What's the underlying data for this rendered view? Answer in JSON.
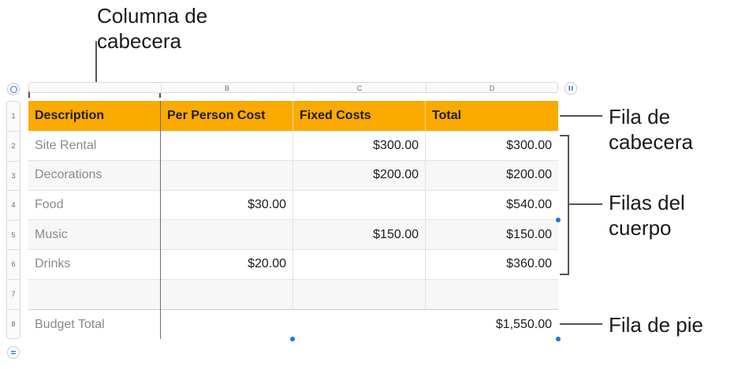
{
  "annotations": {
    "header_column": [
      "Columna de",
      "cabecera"
    ],
    "header_row": [
      "Fila de",
      "cabecera"
    ],
    "body_rows": [
      "Filas del",
      "cuerpo"
    ],
    "footer_row": [
      "Fila de pie"
    ]
  },
  "column_letters": [
    "B",
    "C",
    "D"
  ],
  "row_numbers": [
    "1",
    "2",
    "3",
    "4",
    "5",
    "6",
    "7",
    "8"
  ],
  "table": {
    "header": [
      "Description",
      "Per Person Cost",
      "Fixed Costs",
      "Total"
    ],
    "rows": [
      [
        "Site Rental",
        "",
        "$300.00",
        "$300.00"
      ],
      [
        "Decorations",
        "",
        "$200.00",
        "$200.00"
      ],
      [
        "Food",
        "$30.00",
        "",
        "$540.00"
      ],
      [
        "Music",
        "",
        "$150.00",
        "$150.00"
      ],
      [
        "Drinks",
        "$20.00",
        "",
        "$360.00"
      ],
      [
        "",
        "",
        "",
        ""
      ]
    ],
    "footer": [
      "Budget Total",
      "",
      "",
      "$1,550.00"
    ]
  },
  "colors": {
    "header_fill": "#fbaa00",
    "selection_handle": "#1a73e8"
  },
  "icons": {
    "top_left": "circle-select-icon",
    "top_right": "pause-icon",
    "bottom_left": "equals-icon"
  }
}
